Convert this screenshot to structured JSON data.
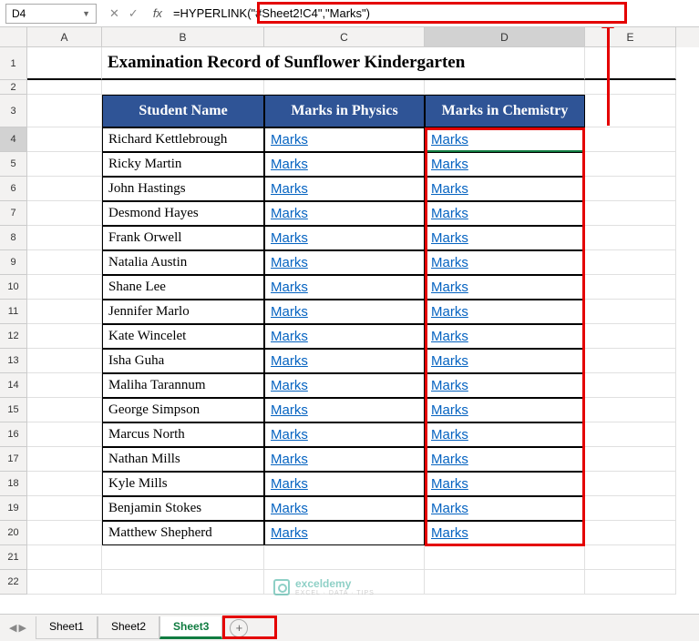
{
  "nameBox": "D4",
  "formula": "=HYPERLINK(\"#Sheet2!C4\",\"Marks\")",
  "cols": [
    "A",
    "B",
    "C",
    "D",
    "E"
  ],
  "title": "Examination Record of Sunflower Kindergarten",
  "headers": {
    "b": "Student Name",
    "c": "Marks in Physics",
    "d": "Marks in Chemistry"
  },
  "linkText": "Marks",
  "students": [
    "Richard Kettlebrough",
    "Ricky Martin",
    "John Hastings",
    "Desmond Hayes",
    "Frank Orwell",
    "Natalia Austin",
    "Shane Lee",
    "Jennifer Marlo",
    "Kate Wincelet",
    "Isha Guha",
    "Maliha Tarannum",
    "George Simpson",
    "Marcus North",
    "Nathan Mills",
    "Kyle Mills",
    "Benjamin Stokes",
    "Matthew Shepherd"
  ],
  "tabs": [
    "Sheet1",
    "Sheet2",
    "Sheet3"
  ],
  "activeTab": "Sheet3",
  "watermark": {
    "brand": "exceldemy",
    "sub": "EXCEL · DATA · TIPS"
  }
}
